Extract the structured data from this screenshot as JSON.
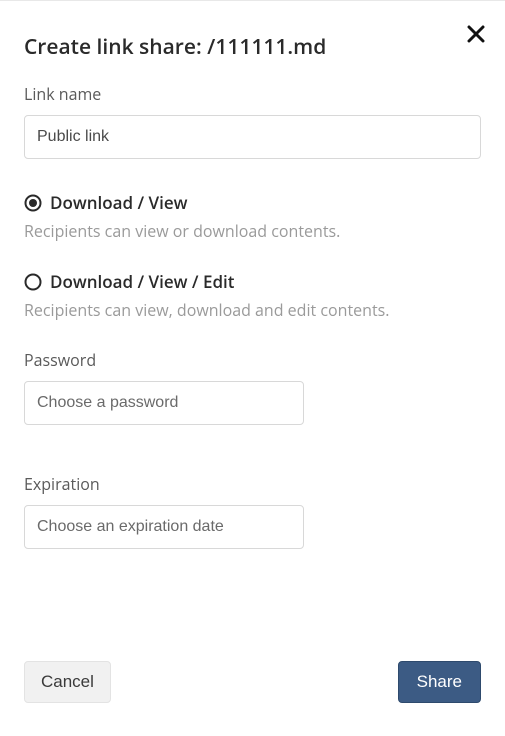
{
  "dialog": {
    "title": "Create link share: /111111.md"
  },
  "linkName": {
    "label": "Link name",
    "value": "Public link"
  },
  "permissions": {
    "option1": {
      "label": "Download / View",
      "desc": "Recipients can view or download contents.",
      "selected": true
    },
    "option2": {
      "label": "Download / View / Edit",
      "desc": "Recipients can view, download and edit contents.",
      "selected": false
    }
  },
  "password": {
    "label": "Password",
    "placeholder": "Choose a password",
    "value": ""
  },
  "expiration": {
    "label": "Expiration",
    "placeholder": "Choose an expiration date",
    "value": ""
  },
  "footer": {
    "cancel": "Cancel",
    "share": "Share"
  }
}
